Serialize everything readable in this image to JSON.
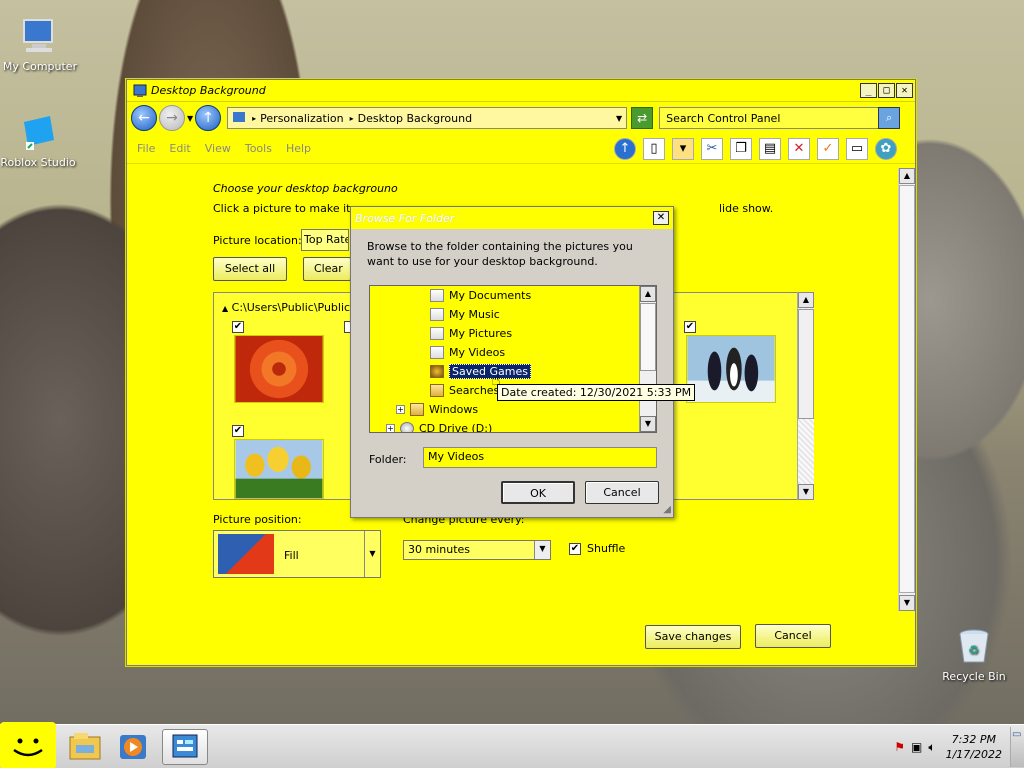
{
  "desktop": {
    "icons": [
      {
        "label": "My Computer"
      },
      {
        "label": "Roblox Studio"
      },
      {
        "label": "Recycle Bin"
      }
    ]
  },
  "window": {
    "title": "Desktop Background",
    "controls": {
      "minimize": "_",
      "maximize": "□",
      "close": "✕"
    },
    "address": {
      "seg1": "Personalization",
      "seg2": "Desktop Background"
    },
    "search_value": "Search Control Panel",
    "menu": [
      "File",
      "Edit",
      "View",
      "Tools",
      "Help"
    ],
    "heading": "Choose your desktop backgrouno",
    "subtext": "Click a picture to make it you",
    "subtext_tail": "lide show.",
    "picture_location_label": "Picture location:",
    "picture_location_value": "Top Rate",
    "select_all": "Select all",
    "clear_all": "Clear a",
    "gallery_path": "C:\\Users\\Public\\Public Pic",
    "picture_position_label": "Picture position:",
    "picture_position_value": "Fill",
    "interval_label": "Change picture every:",
    "interval_value": "30 minutes",
    "shuffle_label": "Shuffle",
    "save_changes": "Save changes",
    "cancel": "Cancel"
  },
  "dialog": {
    "title": "Browse For Folder",
    "description": "Browse to the folder containing the pictures you want to use for your desktop background.",
    "tree": [
      {
        "label": "My Documents"
      },
      {
        "label": "My Music"
      },
      {
        "label": "My Pictures"
      },
      {
        "label": "My Videos"
      },
      {
        "label": "Saved Games",
        "selected": true
      },
      {
        "label": "Searches"
      },
      {
        "label": "Windows",
        "expandable": true
      },
      {
        "label": "CD Drive (D:)",
        "expandable": true
      }
    ],
    "tooltip": "Date created: 12/30/2021 5:33 PM",
    "folder_label": "Folder:",
    "folder_value": "My Videos",
    "ok": "OK",
    "cancel": "Cancel"
  },
  "taskbar": {
    "time": "7:32 PM",
    "date": "1/17/2022"
  },
  "colors": {
    "accent": "#ffff00",
    "selection": "#0a246a"
  }
}
